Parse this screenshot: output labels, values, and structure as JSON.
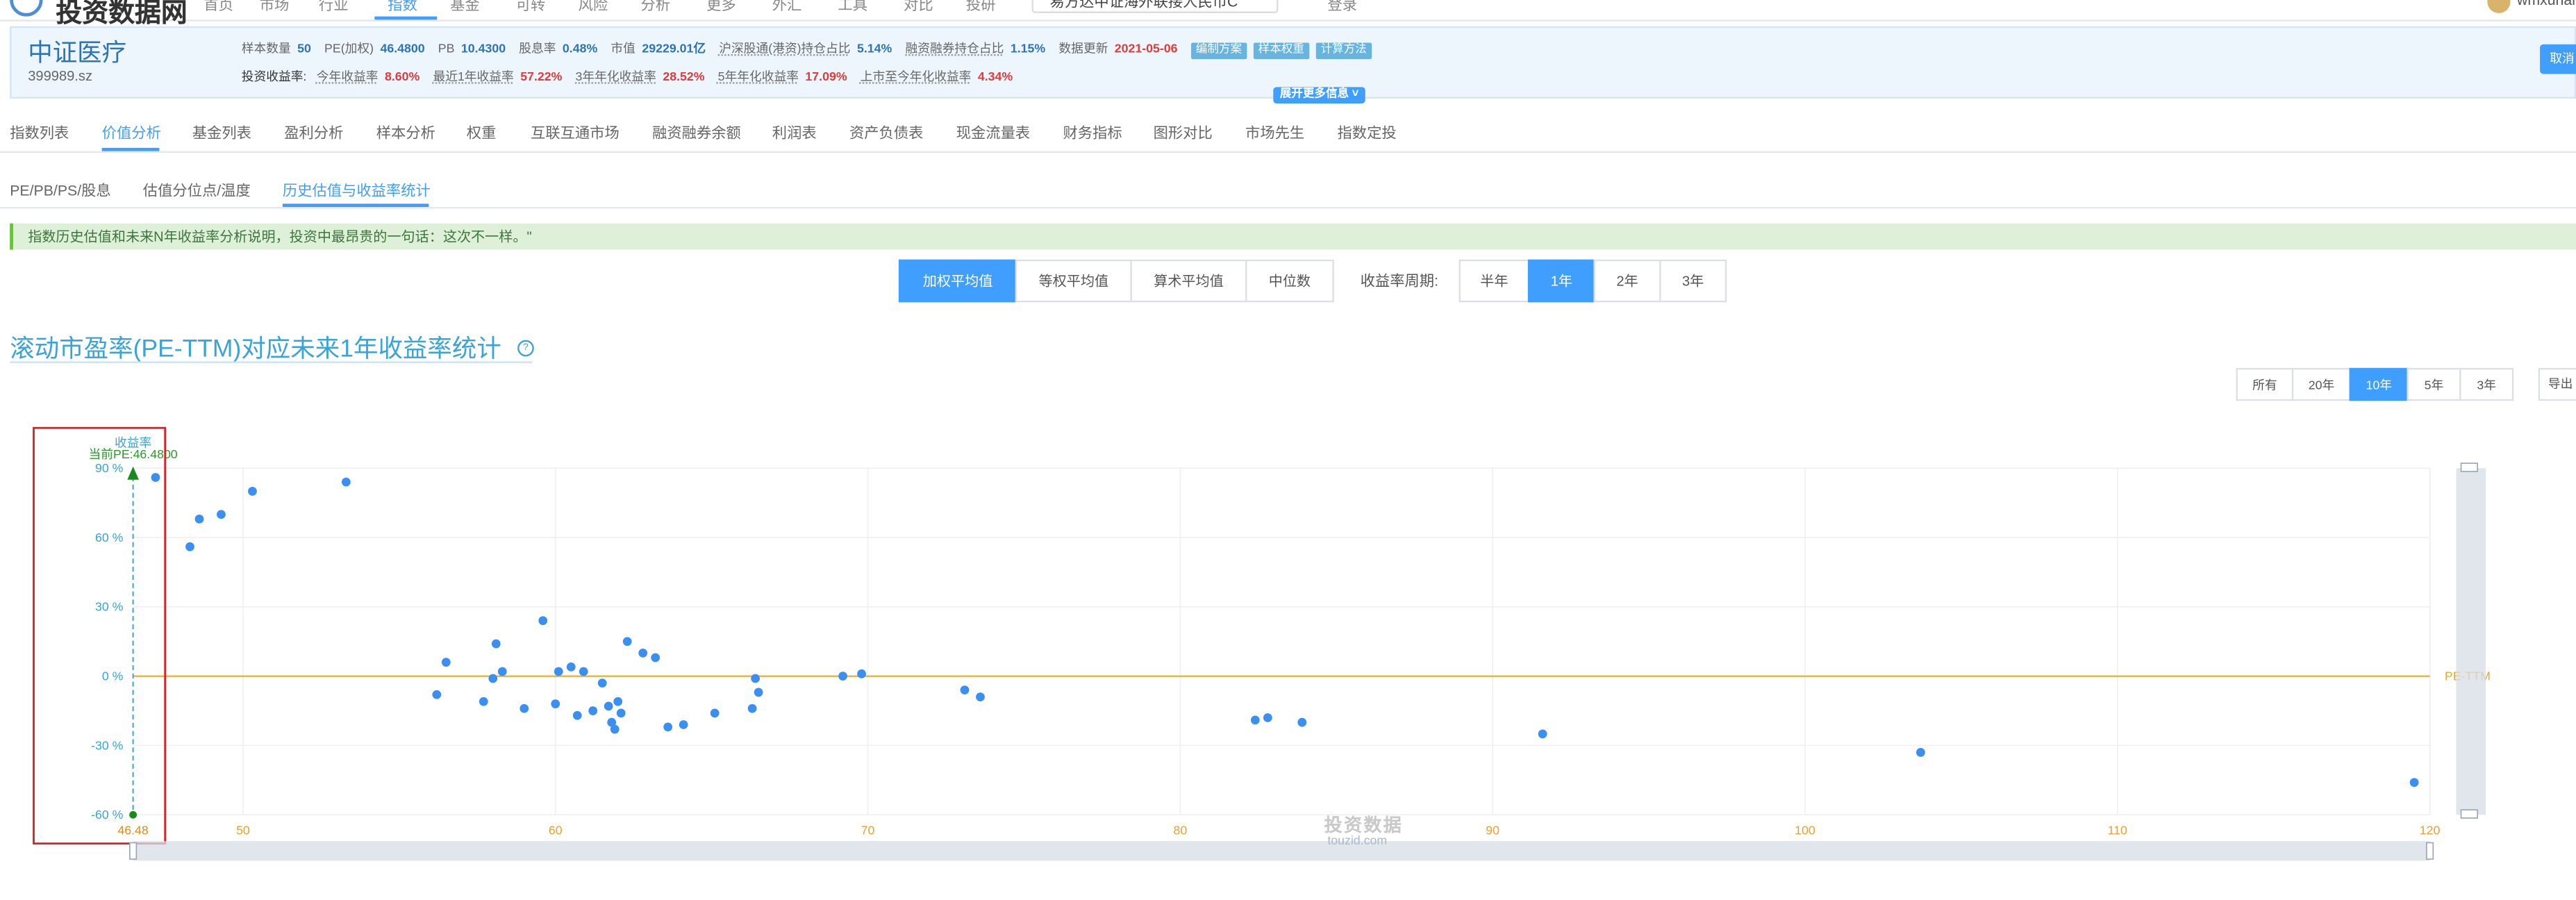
{
  "topnav": {
    "logo": "投资数据网",
    "items": [
      "首页",
      "市场",
      "行业",
      "指数",
      "基金",
      "可转",
      "风险",
      "分析",
      "更多",
      "外汇",
      "工具",
      "对比",
      "投研"
    ],
    "search_value": "易方达中证海外联接人民币C",
    "extra": "登录",
    "user": "wmxuhai"
  },
  "index": {
    "name": "中证医疗",
    "code": "399989.sz",
    "stats": [
      {
        "label": "样本数量",
        "value": "50"
      },
      {
        "label": "PE(加权)",
        "value": "46.4800"
      },
      {
        "label": "PB",
        "value": "10.4300"
      },
      {
        "label": "股息率",
        "value": "0.48%"
      },
      {
        "label": "市值",
        "value": "29229.01亿"
      },
      {
        "label": "沪深股通(港资)持仓占比",
        "value": "5.14%"
      },
      {
        "label": "融资融券持仓占比",
        "value": "1.15%"
      },
      {
        "label": "数据更新",
        "value": "2021-05-06"
      }
    ],
    "tags": [
      "编制方案",
      "样本权重",
      "计算方法"
    ],
    "returns_label": "投资收益率:",
    "returns": [
      {
        "label": "今年收益率",
        "value": "8.60%"
      },
      {
        "label": "最近1年收益率",
        "value": "57.22%"
      },
      {
        "label": "3年年化收益率",
        "value": "28.52%"
      },
      {
        "label": "5年年化收益率",
        "value": "17.09%"
      },
      {
        "label": "上市至今年化收益率",
        "value": "4.34%"
      }
    ],
    "expand_label": "展开更多信息",
    "cancel_label": "取消"
  },
  "main_tabs": [
    "指数列表",
    "价值分析",
    "基金列表",
    "盈利分析",
    "样本分析",
    "权重",
    "互联互通市场",
    "融资融券余额",
    "利润表",
    "资产负债表",
    "现金流量表",
    "财务指标",
    "图形对比",
    "市场先生",
    "指数定投"
  ],
  "main_tab_active": 1,
  "sub_tabs": [
    "PE/PB/PS/股息",
    "估值分位点/温度",
    "历史估值与收益率统计"
  ],
  "sub_tab_active": 2,
  "notice": "指数历史估值和未来N年收益率分析说明，投资中最昂贵的一句话：这次不一样。\"",
  "avg_buttons": [
    "加权平均值",
    "等权平均值",
    "算术平均值",
    "中位数"
  ],
  "avg_active": 0,
  "period_label": "收益率周期:",
  "period_buttons": [
    "半年",
    "1年",
    "2年",
    "3年"
  ],
  "period_active": 1,
  "chart_title": "滚动市盈率(PE-TTM)对应未来1年收益率统计",
  "help_icon": "?",
  "range_buttons": [
    "所有",
    "20年",
    "10年",
    "5年",
    "3年"
  ],
  "range_active": 2,
  "export_label": "导出",
  "watermark": {
    "line1": "投资数据",
    "line2": "touzid.com"
  },
  "colors": {
    "accent": "#409eff",
    "point": "#3b8ff0",
    "zero_line": "#f5a623",
    "current_marker": "#1b8a1b",
    "highlight_box": "#e02020"
  },
  "chart_data": {
    "type": "scatter",
    "title": "滚动市盈率(PE-TTM)对应未来1年收益率统计",
    "ylabel": "收益率",
    "zero_line_label": "PE-TTM",
    "current_label": "当前PE:46.4800",
    "current_pe": 46.48,
    "xlim": [
      46.48,
      120
    ],
    "ylim": [
      -60,
      90
    ],
    "x_ticks": [
      "46.48",
      "50",
      "60",
      "70",
      "80",
      "90",
      "100",
      "110",
      "120"
    ],
    "y_ticks": [
      "90 %",
      "60 %",
      "30 %",
      "0 %",
      "-30 %",
      "-60 %"
    ],
    "grid": true,
    "points": [
      [
        47.2,
        86
      ],
      [
        48.3,
        56
      ],
      [
        48.6,
        68
      ],
      [
        49.3,
        70
      ],
      [
        50.3,
        80
      ],
      [
        53.3,
        84
      ],
      [
        56.2,
        -8
      ],
      [
        56.5,
        6
      ],
      [
        57.7,
        -11
      ],
      [
        58.0,
        -1
      ],
      [
        58.1,
        14
      ],
      [
        58.3,
        2
      ],
      [
        59.0,
        -14
      ],
      [
        59.6,
        24
      ],
      [
        60.0,
        -12
      ],
      [
        60.1,
        2
      ],
      [
        60.5,
        4
      ],
      [
        60.7,
        -17
      ],
      [
        60.9,
        2
      ],
      [
        61.2,
        -15
      ],
      [
        61.5,
        -3
      ],
      [
        61.7,
        -13
      ],
      [
        61.8,
        -20
      ],
      [
        61.9,
        -23
      ],
      [
        62.0,
        -11
      ],
      [
        62.1,
        -16
      ],
      [
        62.3,
        15
      ],
      [
        62.8,
        10
      ],
      [
        63.2,
        8
      ],
      [
        63.6,
        -22
      ],
      [
        64.1,
        -21
      ],
      [
        65.1,
        -16
      ],
      [
        66.3,
        -14
      ],
      [
        66.4,
        -1
      ],
      [
        66.5,
        -7
      ],
      [
        69.2,
        0
      ],
      [
        69.8,
        1
      ],
      [
        73.1,
        -6
      ],
      [
        73.6,
        -9
      ],
      [
        82.4,
        -19
      ],
      [
        82.8,
        -18
      ],
      [
        83.9,
        -20
      ],
      [
        91.6,
        -25
      ],
      [
        103.7,
        -33
      ],
      [
        119.5,
        -46
      ]
    ]
  }
}
